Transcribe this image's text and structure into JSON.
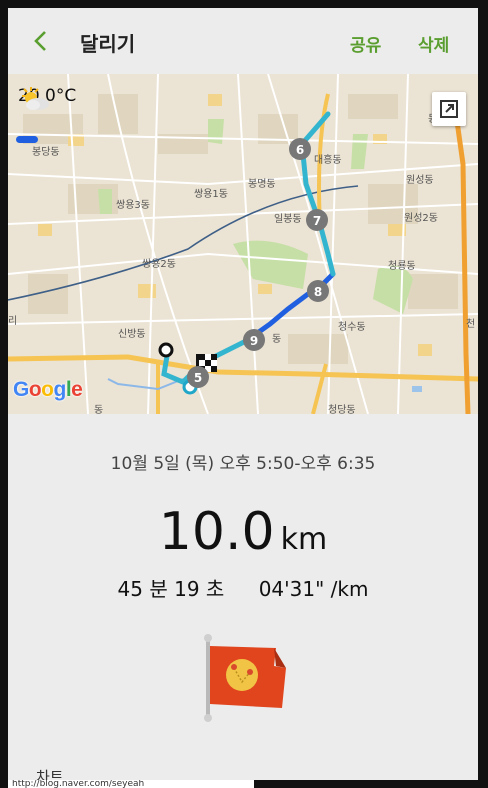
{
  "header": {
    "back_label": "back",
    "title": "달리기",
    "share_label": "공유",
    "delete_label": "삭제"
  },
  "map": {
    "temperature": "20.0°C",
    "weather_icon": "sun-cloud-icon",
    "expand_icon": "expand-icon",
    "labels": {
      "d1": "봉당동",
      "d2": "대흥동",
      "d3": "원성동",
      "d4": "원성2동",
      "d5": "쌍용3동",
      "d6": "쌍용1동",
      "d7": "봉명동",
      "d8": "일봉동",
      "d9": "쌍용2동",
      "d10": "청룡동",
      "d11": "신방동",
      "d12": "청수동",
      "d13": "청당동",
      "d14": "리",
      "d15": "동",
      "d16": "동",
      "d17": "천",
      "d18": "동"
    },
    "km_markers": [
      "5",
      "6",
      "7",
      "8",
      "9"
    ],
    "attribution": [
      "G",
      "o",
      "o",
      "g",
      "l",
      "e"
    ]
  },
  "summary": {
    "date_time": "10월 5일 (목) 오후 5:50-오후 6:35",
    "distance_value": "10.0",
    "distance_unit": "km",
    "duration": "45 분 19 초",
    "pace": "04'31\" /km",
    "badge_icon": "achievement-flag-icon"
  },
  "section": {
    "chart_label": "차트"
  },
  "system": {
    "url_text": "http://blog.naver.com/seyeah"
  },
  "colors": {
    "accent": "#5a9e2f",
    "route_light": "#33b5d0",
    "route_dark": "#2060e0"
  }
}
